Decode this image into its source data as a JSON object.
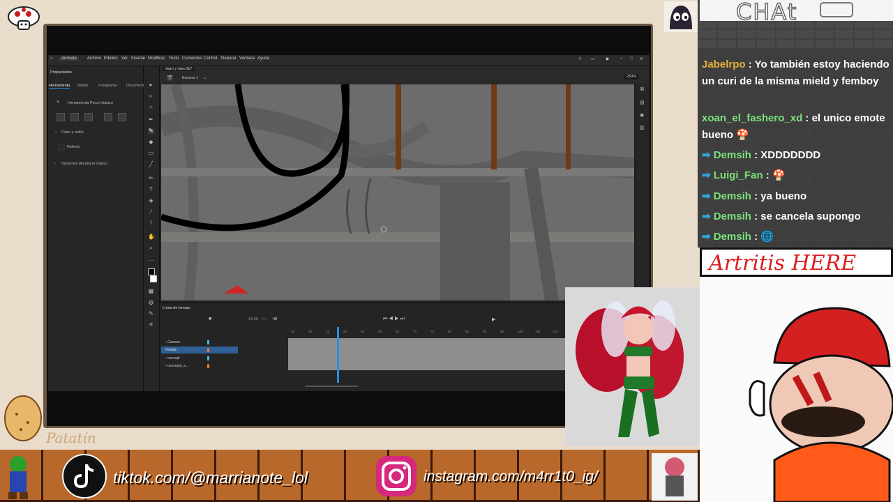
{
  "overlay": {
    "brand_name": "Patatín",
    "tiktok_label": "tiktok.com/@marrianote_lol",
    "instagram_label": "instagram.com/m4rr1t0_ig/",
    "artritis_banner": "Artritis HERE",
    "chat_title": "CHAt"
  },
  "app": {
    "name": "Animate",
    "menu": [
      "Archivo",
      "Edición",
      "Ver",
      "Insertar",
      "Modificar",
      "Texto",
      "Comandos",
      "Control",
      "Depurar",
      "Ventana",
      "Ayuda"
    ],
    "document_tab": "xiaro y oreo.fla*",
    "scene": "Escena 1",
    "zoom": "250%",
    "properties_title": "Propiedades",
    "properties_tabs": [
      "Herramienta",
      "Objeto",
      "Fotograma",
      "Documento"
    ],
    "tool_name": "Herramienta Pincel clásico",
    "color_section": "Color y estilo",
    "fill_label": "Relleno",
    "brush_options": "Opciones del pincel clásico",
    "timeline_title": "Línea de tiempo",
    "fps": "24,00",
    "fps_unit": "FPS",
    "current_frame": "48",
    "frame_ticks": [
      "35",
      "40",
      "45",
      "50",
      "55",
      "60",
      "65",
      "70",
      "75",
      "80",
      "85",
      "90",
      "95",
      "100",
      "105",
      "110",
      "115",
      "120",
      "125"
    ],
    "layers": [
      {
        "name": "Camera"
      },
      {
        "name": "fondo"
      },
      {
        "name": "concept"
      },
      {
        "name": "concepto_s..."
      }
    ]
  },
  "chat": {
    "messages": [
      {
        "user": "Jabelrpo",
        "text": ": Yo también estoy haciendo un curi de la misma mield y femboy"
      },
      {
        "user": "xoan_el_fashero_xd",
        "text": ": el unico emote bueno"
      },
      {
        "user": "Demsih",
        "text": ": XDDDDDDD"
      },
      {
        "user": "Luigi_Fan",
        "text": ":"
      },
      {
        "user": "Demsih",
        "text": ": ya bueno"
      },
      {
        "user": "Demsih",
        "text": ": se cancela supongo"
      },
      {
        "user": "Demsih",
        "text": ":"
      }
    ]
  },
  "colors": {
    "accent": "#2c8de0",
    "chat_user_gold": "#e3b13a",
    "chat_user_green": "#7be07b",
    "banner_brick": "#b8682a"
  }
}
